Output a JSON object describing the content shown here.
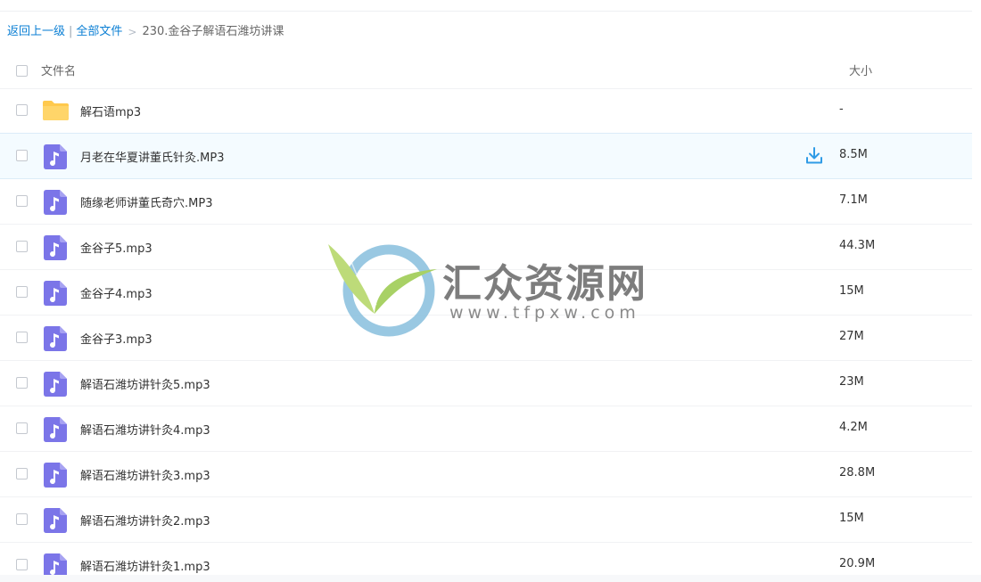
{
  "breadcrumb": {
    "back_label": "返回上一级",
    "separator": "|",
    "all_files_label": "全部文件",
    "arrow": ">",
    "current_folder": "230.金谷子解语石潍坊讲课"
  },
  "table": {
    "headers": {
      "name": "文件名",
      "size": "大小"
    },
    "rows": [
      {
        "type": "folder",
        "name": "解石语mp3",
        "size": "-"
      },
      {
        "type": "audio",
        "name": "月老在华夏讲董氏针灸.MP3",
        "size": "8.5M",
        "hovered": true
      },
      {
        "type": "audio",
        "name": "随缘老师讲董氏奇穴.MP3",
        "size": "7.1M"
      },
      {
        "type": "audio",
        "name": "金谷子5.mp3",
        "size": "44.3M"
      },
      {
        "type": "audio",
        "name": "金谷子4.mp3",
        "size": "15M"
      },
      {
        "type": "audio",
        "name": "金谷子3.mp3",
        "size": "27M"
      },
      {
        "type": "audio",
        "name": "解语石潍坊讲针灸5.mp3",
        "size": "23M"
      },
      {
        "type": "audio",
        "name": "解语石潍坊讲针灸4.mp3",
        "size": "4.2M"
      },
      {
        "type": "audio",
        "name": "解语石潍坊讲针灸3.mp3",
        "size": "28.8M"
      },
      {
        "type": "audio",
        "name": "解语石潍坊讲针灸2.mp3",
        "size": "15M"
      },
      {
        "type": "audio",
        "name": "解语石潍坊讲针灸1.mp3",
        "size": "20.9M"
      }
    ]
  },
  "watermark": {
    "title": "汇众资源网",
    "url": "www.tfpxw.com"
  },
  "icons": {
    "folder": "folder-icon",
    "audio": "music-file-icon",
    "download": "download-icon"
  },
  "colors": {
    "link": "#0b7fd4",
    "folder": "#ffc94d",
    "audio_file": "#7b75e8",
    "download": "#2f9be6",
    "hover_row": "#f4fbff"
  }
}
